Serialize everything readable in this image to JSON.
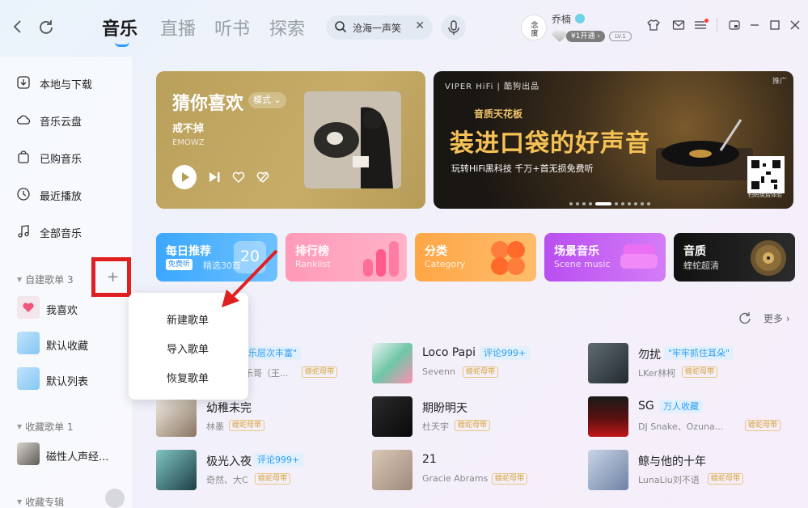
{
  "header": {
    "tabs": [
      "音乐",
      "直播",
      "听书",
      "探索"
    ],
    "active_tab": "音乐",
    "search_value": "沧海一声笑",
    "username": "乔楠",
    "vip_label": "¥1开通 ›",
    "level": "LV.1"
  },
  "sidebar": {
    "items": [
      "本地与下载",
      "音乐云盘",
      "已购音乐",
      "最近播放",
      "全部音乐"
    ],
    "sections": {
      "self_playlists": "自建歌单 3",
      "collected_playlists": "收藏歌单 1",
      "collected_albums": "收藏专辑"
    },
    "playlists": [
      "我喜欢",
      "默认收藏",
      "默认列表"
    ],
    "collected": [
      "磁性人声经..."
    ]
  },
  "context_menu": {
    "items": [
      "新建歌单",
      "导入歌单",
      "恢复歌单"
    ]
  },
  "guess": {
    "title": "猜你喜欢",
    "mode": "模式",
    "song": "戒不掉",
    "artist": "EMOWZ"
  },
  "banner": {
    "brand": "VIPER HiFi | 酷狗出品",
    "tag": "推广",
    "subtitle": "音质天花板",
    "title": "装进口袋的好声音",
    "desc": "玩转HiFi黑科技 千万+首无损免费听",
    "qr_caption": "扫码免费体验"
  },
  "tiles": [
    {
      "title": "每日推荐",
      "sub": "精选30首",
      "badge": "免费听",
      "day": "20",
      "color": "#3fa9ff"
    },
    {
      "title": "排行榜",
      "sub": "Ranklist",
      "color": "#ff8fb0"
    },
    {
      "title": "分类",
      "sub": "Category",
      "color": "#ffa94a"
    },
    {
      "title": "场景音乐",
      "sub": "Scene music",
      "color": "#c45cf0"
    },
    {
      "title": "音质",
      "sub": "蝰蛇超清",
      "color": "#1c1c1c"
    }
  ],
  "songs_header": {
    "more": "更多 ›"
  },
  "songs": [
    {
      "title": "",
      "tag": "乐层次丰富\"",
      "artist": "乐哥（王...",
      "src": "蝰蛇母带"
    },
    {
      "title": "Loco Papi",
      "tag": "评论999+",
      "artist": "Sevenn",
      "src": "蝰蛇母带"
    },
    {
      "title": "勿扰",
      "tag": "\"牢牢抓住耳朵\"",
      "artist": "LKer林柯",
      "src": "蝰蛇母带"
    },
    {
      "title": "幼稚未完",
      "tag": "",
      "artist": "林墨",
      "src": "蝰蛇母带"
    },
    {
      "title": "期盼明天",
      "tag": "",
      "artist": "杜天宇",
      "src": "蝰蛇母带"
    },
    {
      "title": "SG",
      "tag": "万人收藏",
      "artist": "DJ Snake、Ozuna...",
      "src": "蝰蛇母带"
    },
    {
      "title": "极光入夜",
      "tag": "评论999+",
      "artist": "奇然、大C",
      "src": "蝰蛇母带"
    },
    {
      "title": "21",
      "tag": "",
      "artist": "Gracie Abrams",
      "src": "蝰蛇母带"
    },
    {
      "title": "鲸与他的十年",
      "tag": "",
      "artist": "LunaLiu刘不语",
      "src": "蝰蛇母带"
    }
  ]
}
